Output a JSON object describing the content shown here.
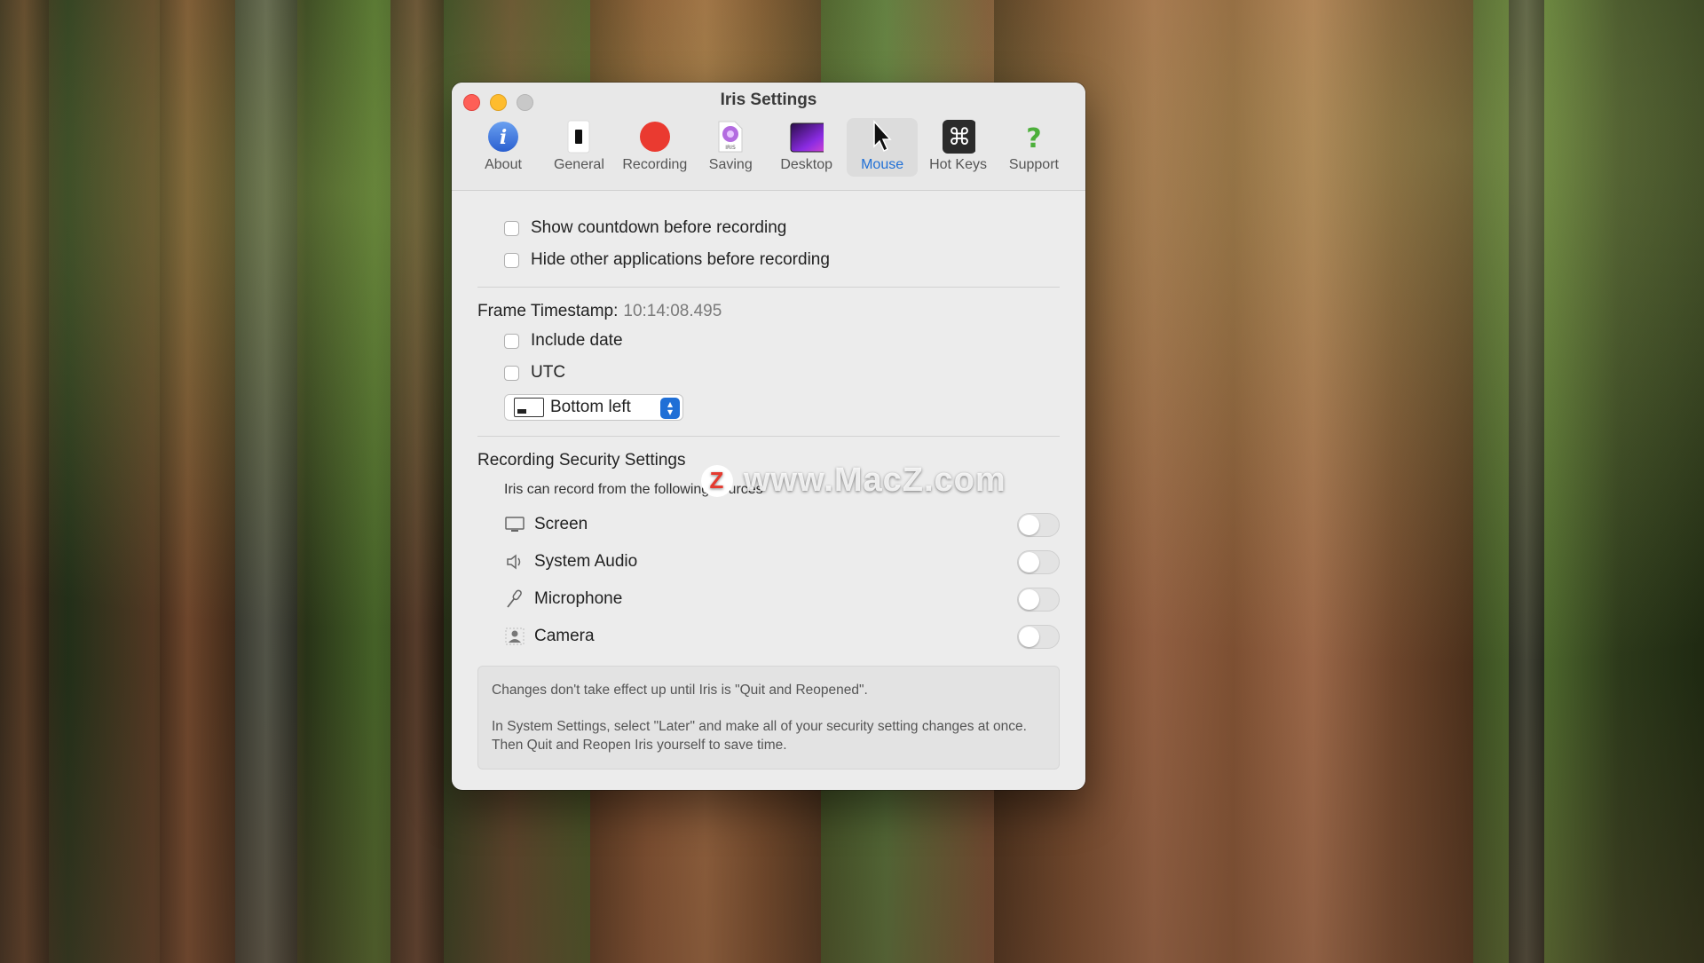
{
  "window": {
    "title": "Iris Settings"
  },
  "toolbar": {
    "items": [
      {
        "label": "About",
        "icon": "info-icon"
      },
      {
        "label": "General",
        "icon": "device-icon"
      },
      {
        "label": "Recording",
        "icon": "record-icon"
      },
      {
        "label": "Saving",
        "icon": "iris-file-icon"
      },
      {
        "label": "Desktop",
        "icon": "desktop-icon"
      },
      {
        "label": "Mouse",
        "icon": "pointer-icon"
      },
      {
        "label": "Hot Keys",
        "icon": "command-icon"
      },
      {
        "label": "Support",
        "icon": "question-icon"
      }
    ],
    "active": "Mouse",
    "accent": "#1f6fd6"
  },
  "options": {
    "countdown": {
      "label": "Show countdown before recording",
      "checked": false
    },
    "hide_apps": {
      "label": "Hide other applications before recording",
      "checked": false
    }
  },
  "timestamp": {
    "label": "Frame Timestamp:",
    "value": "10:14:08.495",
    "include_date": {
      "label": "Include date",
      "checked": false
    },
    "utc": {
      "label": "UTC",
      "checked": false
    },
    "position": {
      "value": "Bottom left"
    }
  },
  "security": {
    "heading": "Recording Security Settings",
    "note": "Iris can record from the following sources",
    "sources": [
      {
        "label": "Screen",
        "icon": "display-icon",
        "enabled": false
      },
      {
        "label": "System Audio",
        "icon": "speaker-icon",
        "enabled": false
      },
      {
        "label": "Microphone",
        "icon": "microphone-icon",
        "enabled": false
      },
      {
        "label": "Camera",
        "icon": "camera-person-icon",
        "enabled": false
      }
    ],
    "notice_1": "Changes don't take effect up until Iris is \"Quit and Reopened\".",
    "notice_2": "In System Settings, select \"Later\" and make all of your security setting changes at once. Then Quit and Reopen Iris yourself to save time."
  },
  "watermark": {
    "text": "www.MacZ.com",
    "badge": "Z"
  }
}
